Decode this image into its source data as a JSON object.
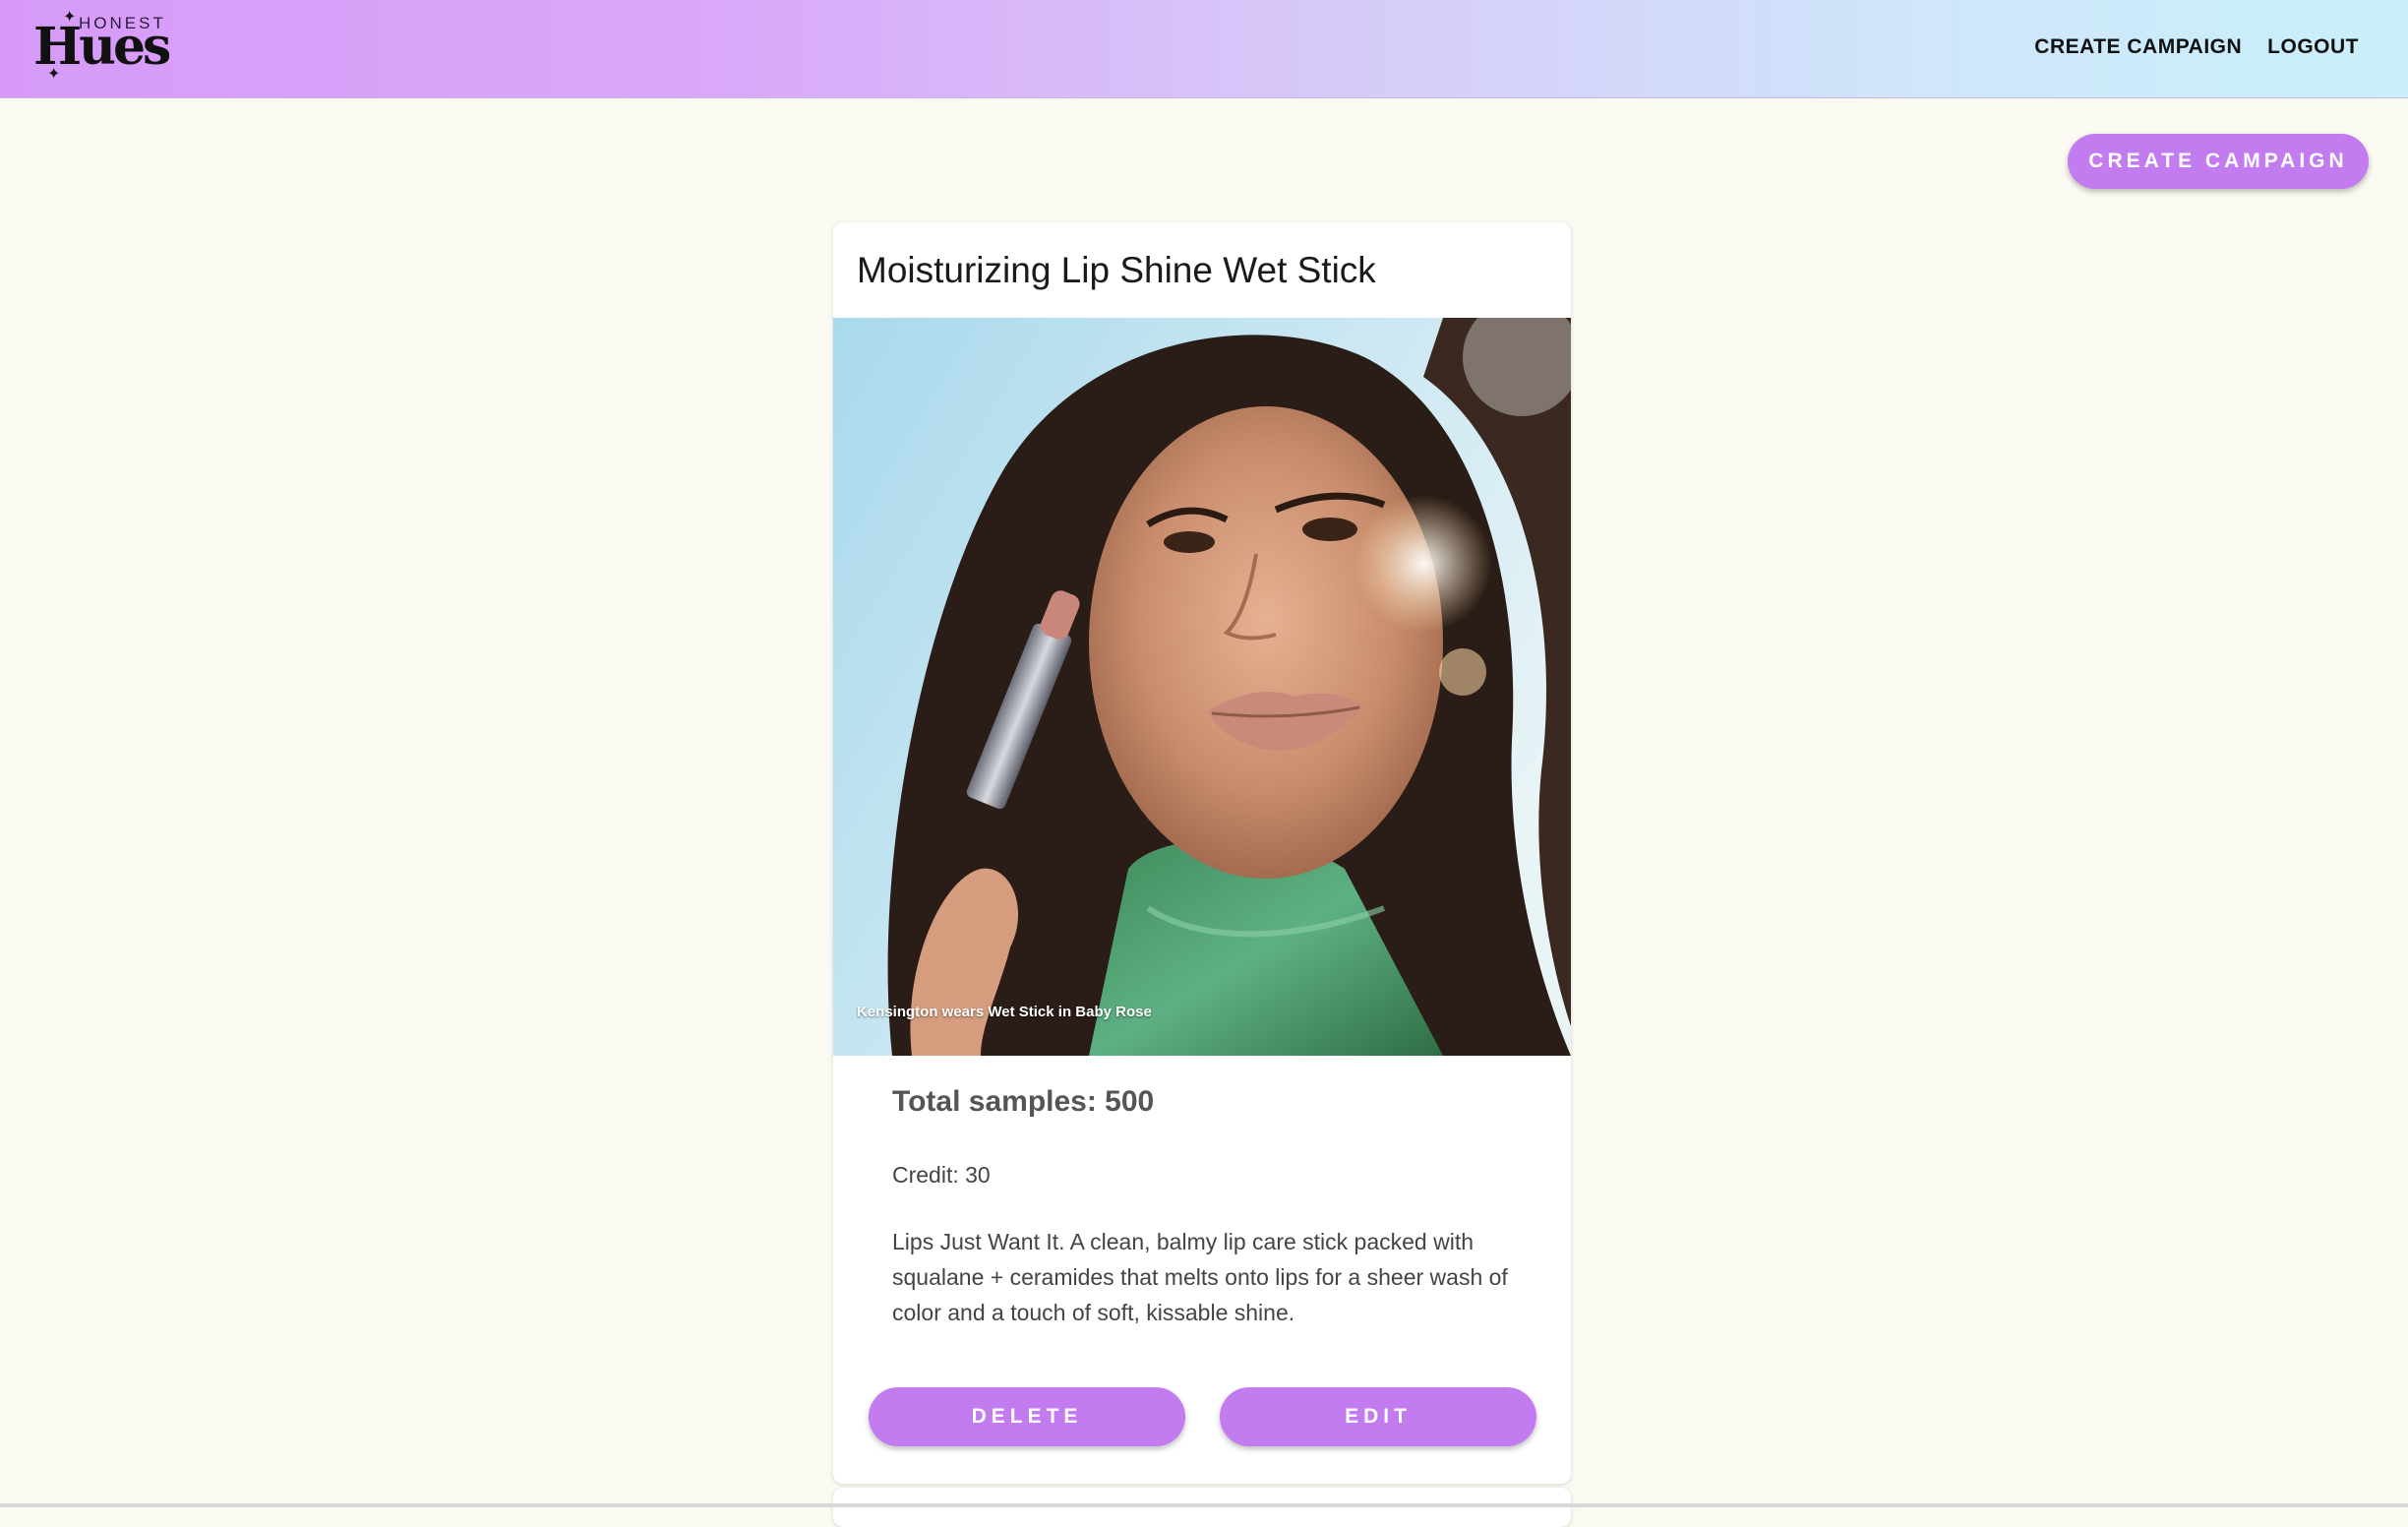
{
  "brand": {
    "top": "HONEST",
    "name": "Hues"
  },
  "nav": {
    "links": [
      "CREATE CAMPAIGN",
      "LOGOUT"
    ]
  },
  "create_button_label": "CREATE CAMPAIGN",
  "campaign": {
    "title": "Moisturizing Lip Shine Wet Stick",
    "image_caption": "Kensington wears Wet Stick in Baby Rose",
    "samples": "Total samples: 500",
    "credit": "Credit: 30",
    "description": "Lips Just Want It. A clean, balmy lip care stick packed with squalane + ceramides that melts onto lips for a sheer wash of color and a touch of soft, kissable shine.",
    "buttons": {
      "delete": "DELETE",
      "edit": "EDIT"
    }
  },
  "colors": {
    "accent": "#c27cf0",
    "background": "#fafaf2",
    "nav_gradient_start": "#d79af8",
    "nav_gradient_end": "#c9f0fb"
  }
}
